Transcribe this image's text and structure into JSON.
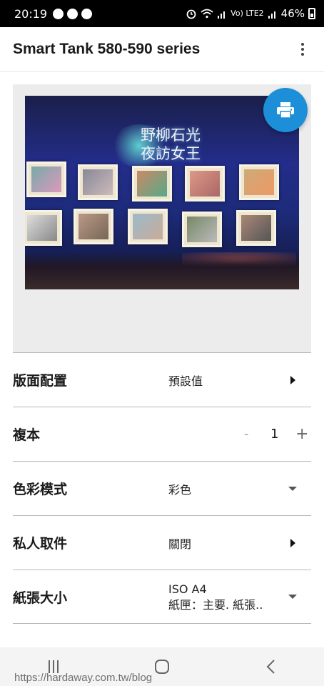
{
  "status_bar": {
    "time": "20:19",
    "network_label": "Vo) LTE2",
    "battery": "46%"
  },
  "app_bar": {
    "title": "Smart Tank 580-590 series"
  },
  "preview": {
    "caption_line1": "野柳石光",
    "caption_line2": "夜訪女王"
  },
  "settings": [
    {
      "label": "版面配置",
      "value": "預設值",
      "control": "arrow"
    },
    {
      "label": "複本",
      "value": "1",
      "control": "stepper",
      "minus": "-",
      "plus": "+"
    },
    {
      "label": "色彩模式",
      "value": "彩色",
      "control": "dropdown"
    },
    {
      "label": "私人取件",
      "value": "關閉",
      "control": "arrow"
    },
    {
      "label": "紙張大小",
      "value": "ISO A4",
      "value_line2": "紙匣：主要. 紙張..",
      "control": "dropdown"
    }
  ],
  "watermark": "https://hardaway.com.tw/blog",
  "icons": {
    "print": "print-icon",
    "more": "more-vert-icon",
    "nav_recent": "recent-apps-icon",
    "nav_home": "home-icon",
    "nav_back": "back-icon"
  },
  "colors": {
    "fab": "#1d8fd8"
  }
}
